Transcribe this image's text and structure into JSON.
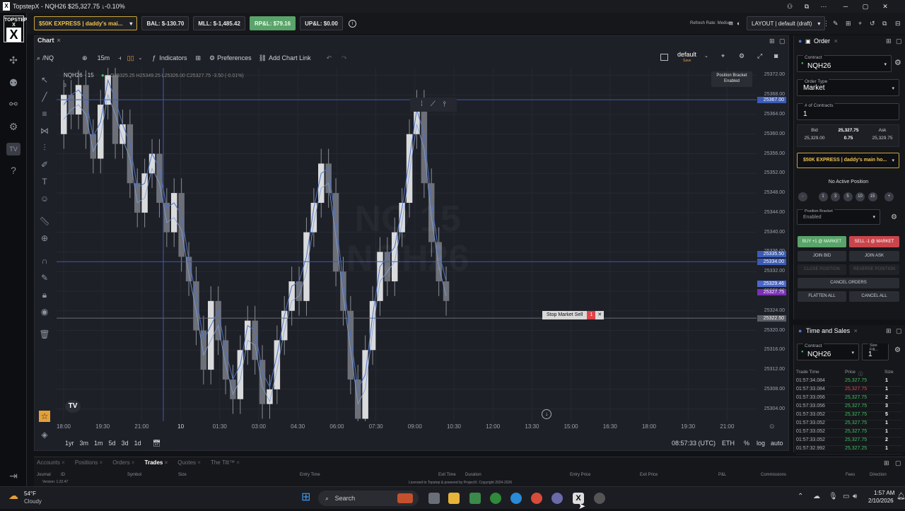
{
  "window": {
    "title": "TopstepX - NQH26 $25,327.75 ↓-0.10%"
  },
  "sidebar": {
    "logo": "TOPSTEP X"
  },
  "topbar": {
    "account": "$50K EXPRESS | daddy's mai...",
    "bal": "BAL: $-130.70",
    "mll": "MLL: $-1,485.42",
    "rpnl": "RP&L: $79.16",
    "upnl": "UP&L: $0.00",
    "refresh": "Refresh Rate: Medium",
    "layout": "LAYOUT | default (draft)"
  },
  "chart": {
    "tab": "Chart",
    "symbol": "/NQ",
    "interval": "15m",
    "indicators": "Indicators",
    "preferences": "Preferences",
    "add_link": "Add Chart Link",
    "template": "default",
    "template_sub": "Save",
    "legend_symbol": "NQH26 · 15",
    "legend_ohlc": "O25325.25  H25349.25  L25326.00  C25327.75  -3.50 (-0.01%)",
    "legend_count": "3",
    "watermark1": "NQ 15",
    "watermark2": "NQH26",
    "position_bracket": "Position Bracket",
    "position_bracket_sub": "Enabled",
    "stop_label": "Stop Market Sell",
    "stop_qty": "1",
    "time_display": "08:57:33 (UTC)",
    "session": "ETH",
    "pct": "%",
    "log": "log",
    "auto": "auto",
    "ranges": [
      "1yr",
      "3m",
      "1m",
      "5d",
      "3d",
      "1d"
    ],
    "y_ticks": [
      "25372.00",
      "25368.00",
      "25364.00",
      "25360.00",
      "25356.00",
      "25352.00",
      "25348.00",
      "25344.00",
      "25340.00",
      "25336.00",
      "25332.00",
      "25328.00",
      "25324.00",
      "25320.00",
      "25316.00",
      "25312.00",
      "25308.00",
      "25304.00"
    ],
    "y_tags": [
      {
        "text": "25367.00",
        "color": "#3b5bb5"
      },
      {
        "text": "25335.50",
        "color": "#3b5bb5"
      },
      {
        "text": "25334.00",
        "color": "#3b5bb5"
      },
      {
        "text": "25329.46",
        "color": "#4a67c9"
      },
      {
        "text": "25327.75",
        "color": "#7a2fb5"
      },
      {
        "text": "25322.50",
        "color": "#5a5d66"
      }
    ],
    "x_ticks": [
      "18:00",
      "19:30",
      "21:00",
      "10",
      "01:30",
      "03:00",
      "04:30",
      "06:00",
      "07:30",
      "09:00",
      "10:30",
      "12:00",
      "13:30",
      "15:00",
      "16:30",
      "18:00",
      "19:30",
      "21:00"
    ]
  },
  "order": {
    "title": "Order",
    "contract_label": "Contract",
    "contract": "NQH26",
    "type_label": "Order Type",
    "type": "Market",
    "contracts_label": "# of Contracts",
    "contracts": "1",
    "bid_label": "Bid",
    "bid": "25,329.00",
    "last": "25,327.75",
    "spread": "0.75",
    "ask_label": "Ask",
    "ask": "25,329.75",
    "account": "$50K EXPRESS | daddy's main ho...",
    "no_position": "No Active Position",
    "qty_buttons": [
      "-",
      "1",
      "3",
      "5",
      "10",
      "15",
      "+"
    ],
    "bracket_label": "Position Bracket",
    "bracket": "Enabled",
    "buy": "BUY +1 @ MARKET",
    "sell": "SELL -1 @ MARKET",
    "join_bid": "JOIN BID",
    "join_ask": "JOIN ASK",
    "close_pos": "CLOSE POSITION",
    "reverse_pos": "REVERSE POSITION",
    "cancel_orders": "CANCEL ORDERS",
    "flatten": "FLATTEN ALL",
    "cancel_all": "CANCEL ALL"
  },
  "timesales": {
    "title": "Time and Sales",
    "contract_label": "Contract",
    "contract": "NQH26",
    "size_label": "Size Filt...",
    "size": "1",
    "col_time": "Trade Time",
    "col_price": "Price",
    "col_size": "Size",
    "rows": [
      {
        "t": "01:57:34.084",
        "p": "25,327.75",
        "s": "1",
        "c": "#3fbf5f"
      },
      {
        "t": "01:57:33.084",
        "p": "25,327.75",
        "s": "1",
        "c": "#e0444a"
      },
      {
        "t": "01:57:33.056",
        "p": "25,327.75",
        "s": "2",
        "c": "#3fbf5f"
      },
      {
        "t": "01:57:33.056",
        "p": "25,327.75",
        "s": "3",
        "c": "#3fbf5f"
      },
      {
        "t": "01:57:33.052",
        "p": "25,327.75",
        "s": "5",
        "c": "#3fbf5f"
      },
      {
        "t": "01:57:33.052",
        "p": "25,327.75",
        "s": "1",
        "c": "#3fbf5f"
      },
      {
        "t": "01:57:33.052",
        "p": "25,327.75",
        "s": "1",
        "c": "#3fbf5f"
      },
      {
        "t": "01:57:33.052",
        "p": "25,327.75",
        "s": "2",
        "c": "#3fbf5f"
      },
      {
        "t": "01:57:32.992",
        "p": "25,327.25",
        "s": "1",
        "c": "#3fbf5f"
      }
    ]
  },
  "bottom": {
    "tabs": [
      "Accounts",
      "Positions",
      "Orders",
      "Trades",
      "Quotes",
      "The Tilt™"
    ],
    "active": "Trades",
    "cols": [
      "Journal",
      "ID",
      "Symbol",
      "Size",
      "Entry Time",
      "Exit Time",
      "Duration",
      "Entry Price",
      "Exit Price",
      "P&L",
      "Commissions",
      "Fees",
      "Direction"
    ],
    "license": "Licensed to Topstep & powered by ProjectX. Copyright 2024-2026",
    "version": "Version: 1.22.47"
  },
  "taskbar": {
    "weather_temp": "54°F",
    "weather_desc": "Cloudy",
    "search": "Search",
    "time": "1:57 AM",
    "date": "2/10/2026"
  }
}
